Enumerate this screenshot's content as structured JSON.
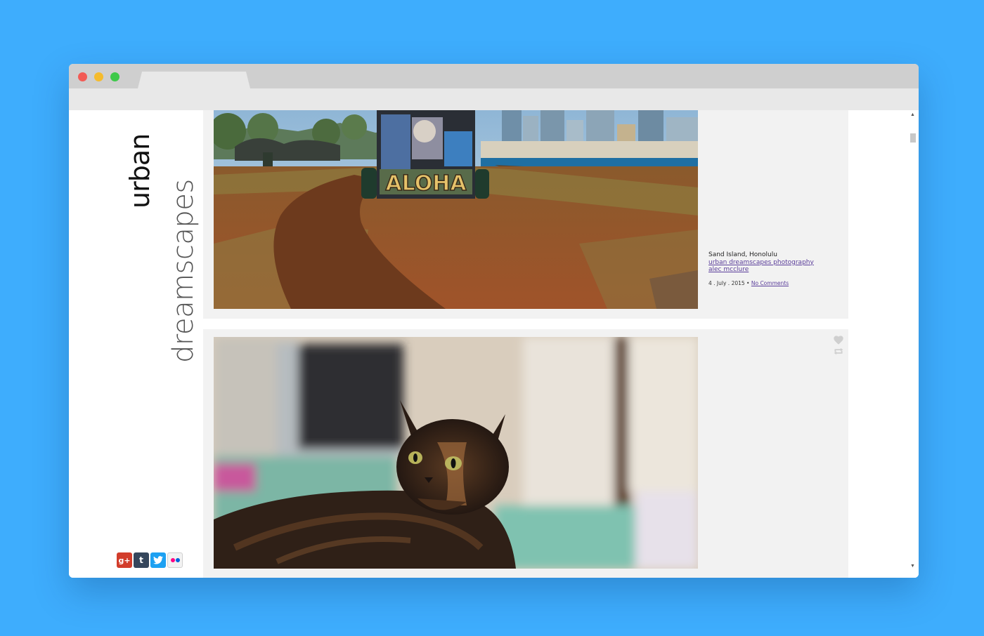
{
  "site": {
    "logo_line1": "urban",
    "logo_line2": "dreamscapes"
  },
  "sidebar": {
    "social_links": [
      {
        "label": "g+",
        "icon": "google-plus-icon",
        "color": "#d23d2b"
      },
      {
        "label": "t",
        "icon": "tumblr-icon",
        "color": "#35465c"
      },
      {
        "label": "twitter",
        "icon": "twitter-icon",
        "color": "#1da1f2"
      },
      {
        "label": "flickr",
        "icon": "flickr-icon",
        "color": "#ff0084"
      }
    ]
  },
  "posts": [
    {
      "image": "park-graffiti-photo",
      "graffiti_text": "ALOHA",
      "caption": {
        "title": "Sand Island, Honolulu",
        "link1": "urban dreamscapes photography",
        "link2": "alec mcclure",
        "date": "4 . July . 2015 •",
        "comments": "No Comments"
      }
    },
    {
      "image": "tortoiseshell-cat-photo",
      "actions": [
        "heart-icon",
        "reblog-icon"
      ]
    }
  ],
  "colors": {
    "background": "#3eadfd",
    "post_bg": "#f2f2f2",
    "link": "#5a3d9a"
  }
}
